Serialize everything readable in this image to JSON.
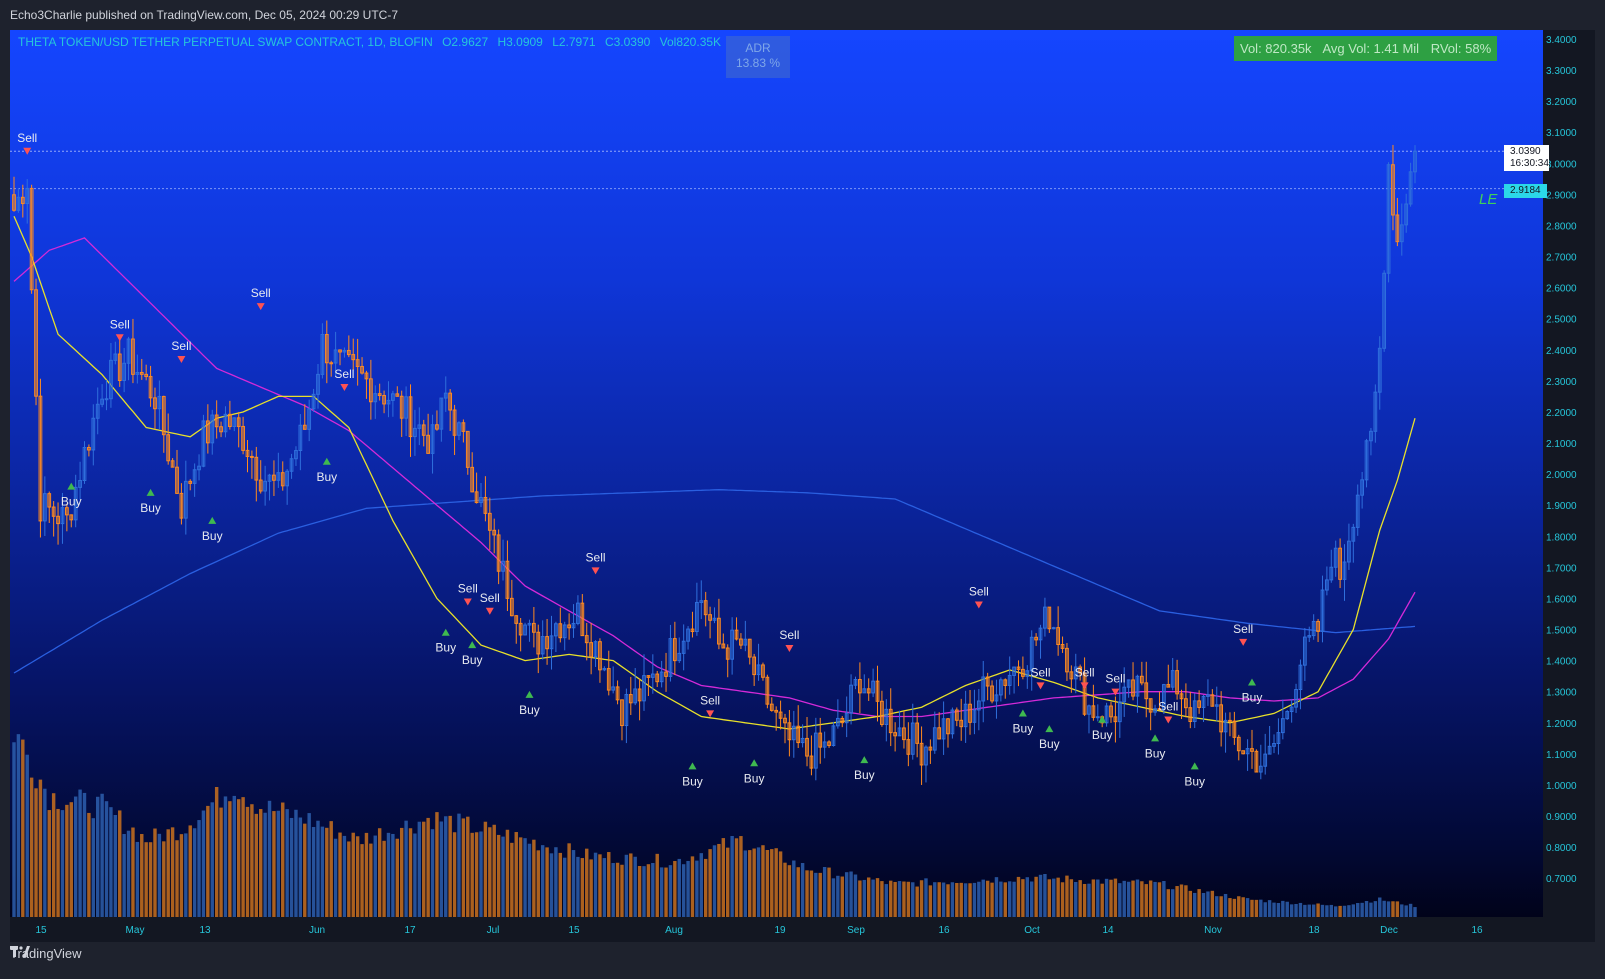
{
  "header": {
    "published_text": "Echo3Charlie published on TradingView.com, Dec 05, 2024 00:29 UTC-7"
  },
  "legend": {
    "symbol": "THETA TOKEN/USD TETHER PERPETUAL SWAP CONTRACT, 1D, BLOFIN",
    "open": "O2.9627",
    "high": "H3.0909",
    "low": "L2.7971",
    "close": "C3.0390",
    "volume": "Vol820.35K"
  },
  "adr": {
    "label": "ADR",
    "value": "13.83 %"
  },
  "volume_box": {
    "vol": "Vol: 820.35k",
    "avg": "Avg Vol: 1.41 Mil",
    "rvol": "RVol: 58%"
  },
  "le_label": "LE",
  "price_labels": {
    "last": "3.0390",
    "countdown": "16:30:34",
    "line2": "2.9184"
  },
  "footer": {
    "brand": "TradingView"
  },
  "colors": {
    "up": "#2f6fdc",
    "down": "#ff8a1f",
    "ma_fast": "#e8e02a",
    "ma_mid": "#d42ad8",
    "ma_slow": "#2a5fe0",
    "buy": "#3fb950",
    "sell": "#ff5252"
  },
  "chart_data": {
    "type": "candlestick",
    "y_axis": {
      "ticks": [
        "3.4000",
        "3.3000",
        "3.2000",
        "3.1000",
        "3.0000",
        "2.9000",
        "2.8000",
        "2.7000",
        "2.6000",
        "2.5000",
        "2.4000",
        "2.3000",
        "2.2000",
        "2.1000",
        "2.0000",
        "1.9000",
        "1.8000",
        "1.7000",
        "1.6000",
        "1.5000",
        "1.4000",
        "1.3000",
        "1.2000",
        "1.1000",
        "1.0000",
        "0.9000",
        "0.8000",
        "0.7000"
      ],
      "range": [
        0.67,
        3.42
      ]
    },
    "x_axis": {
      "ticks": [
        "15",
        "May",
        "13",
        "Jun",
        "17",
        "Jul",
        "15",
        "Aug",
        "19",
        "Sep",
        "16",
        "Oct",
        "14",
        "Nov",
        "18",
        "Dec",
        "16"
      ]
    },
    "close_path": [
      [
        0,
        2.85
      ],
      [
        3,
        2.95
      ],
      [
        6,
        1.9
      ],
      [
        12,
        1.85
      ],
      [
        20,
        2.28
      ],
      [
        26,
        2.38
      ],
      [
        32,
        2.25
      ],
      [
        38,
        1.9
      ],
      [
        43,
        2.12
      ],
      [
        48,
        2.18
      ],
      [
        52,
        2.12
      ],
      [
        56,
        2.0
      ],
      [
        60,
        1.95
      ],
      [
        66,
        2.15
      ],
      [
        70,
        2.42
      ],
      [
        74,
        2.35
      ],
      [
        80,
        2.3
      ],
      [
        85,
        2.25
      ],
      [
        90,
        2.18
      ],
      [
        95,
        2.1
      ],
      [
        98,
        2.25
      ],
      [
        103,
        2.05
      ],
      [
        108,
        1.8
      ],
      [
        113,
        1.6
      ],
      [
        118,
        1.45
      ],
      [
        123,
        1.52
      ],
      [
        128,
        1.55
      ],
      [
        133,
        1.42
      ],
      [
        138,
        1.25
      ],
      [
        143,
        1.3
      ],
      [
        148,
        1.4
      ],
      [
        152,
        1.5
      ],
      [
        156,
        1.6
      ],
      [
        160,
        1.45
      ],
      [
        165,
        1.45
      ],
      [
        170,
        1.3
      ],
      [
        175,
        1.15
      ],
      [
        180,
        1.1
      ],
      [
        184,
        1.12
      ],
      [
        188,
        1.2
      ],
      [
        192,
        1.35
      ],
      [
        196,
        1.25
      ],
      [
        201,
        1.18
      ],
      [
        206,
        1.12
      ],
      [
        210,
        1.18
      ],
      [
        215,
        1.2
      ],
      [
        220,
        1.3
      ],
      [
        225,
        1.35
      ],
      [
        230,
        1.42
      ],
      [
        235,
        1.55
      ],
      [
        239,
        1.42
      ],
      [
        244,
        1.25
      ],
      [
        249,
        1.22
      ],
      [
        254,
        1.3
      ],
      [
        259,
        1.28
      ],
      [
        264,
        1.32
      ],
      [
        268,
        1.22
      ],
      [
        272,
        1.28
      ],
      [
        276,
        1.15
      ],
      [
        281,
        1.1
      ],
      [
        284,
        1.06
      ],
      [
        288,
        1.2
      ],
      [
        292,
        1.4
      ],
      [
        296,
        1.5
      ],
      [
        299,
        1.75
      ],
      [
        301,
        1.68
      ],
      [
        305,
        1.95
      ],
      [
        308,
        2.1
      ],
      [
        310,
        2.4
      ],
      [
        312,
        3.0
      ],
      [
        314,
        2.75
      ],
      [
        316,
        2.9
      ],
      [
        318,
        3.04
      ]
    ],
    "volume_profile": [
      [
        0,
        0.85
      ],
      [
        8,
        0.55
      ],
      [
        20,
        0.5
      ],
      [
        30,
        0.35
      ],
      [
        38,
        0.4
      ],
      [
        50,
        0.6
      ],
      [
        56,
        0.5
      ],
      [
        66,
        0.45
      ],
      [
        78,
        0.35
      ],
      [
        95,
        0.45
      ],
      [
        110,
        0.38
      ],
      [
        130,
        0.28
      ],
      [
        150,
        0.25
      ],
      [
        165,
        0.35
      ],
      [
        180,
        0.22
      ],
      [
        200,
        0.15
      ],
      [
        230,
        0.18
      ],
      [
        260,
        0.15
      ],
      [
        280,
        0.08
      ],
      [
        300,
        0.05
      ],
      [
        310,
        0.08
      ],
      [
        318,
        0.05
      ]
    ],
    "ma_fast": [
      [
        0,
        2.83
      ],
      [
        4,
        2.7
      ],
      [
        10,
        2.45
      ],
      [
        20,
        2.32
      ],
      [
        30,
        2.15
      ],
      [
        40,
        2.12
      ],
      [
        46,
        2.18
      ],
      [
        52,
        2.2
      ],
      [
        60,
        2.25
      ],
      [
        68,
        2.25
      ],
      [
        76,
        2.15
      ],
      [
        86,
        1.85
      ],
      [
        96,
        1.6
      ],
      [
        106,
        1.45
      ],
      [
        116,
        1.4
      ],
      [
        126,
        1.42
      ],
      [
        136,
        1.4
      ],
      [
        146,
        1.3
      ],
      [
        156,
        1.22
      ],
      [
        166,
        1.2
      ],
      [
        176,
        1.18
      ],
      [
        186,
        1.2
      ],
      [
        196,
        1.22
      ],
      [
        206,
        1.25
      ],
      [
        216,
        1.32
      ],
      [
        226,
        1.37
      ],
      [
        236,
        1.33
      ],
      [
        246,
        1.28
      ],
      [
        256,
        1.25
      ],
      [
        266,
        1.22
      ],
      [
        276,
        1.2
      ],
      [
        286,
        1.23
      ],
      [
        296,
        1.3
      ],
      [
        304,
        1.5
      ],
      [
        310,
        1.82
      ],
      [
        314,
        1.98
      ],
      [
        318,
        2.18
      ]
    ],
    "ma_mid": [
      [
        0,
        2.62
      ],
      [
        8,
        2.72
      ],
      [
        16,
        2.76
      ],
      [
        26,
        2.62
      ],
      [
        36,
        2.48
      ],
      [
        46,
        2.34
      ],
      [
        56,
        2.28
      ],
      [
        66,
        2.22
      ],
      [
        76,
        2.14
      ],
      [
        86,
        2.02
      ],
      [
        96,
        1.9
      ],
      [
        106,
        1.78
      ],
      [
        116,
        1.64
      ],
      [
        126,
        1.56
      ],
      [
        136,
        1.48
      ],
      [
        146,
        1.38
      ],
      [
        156,
        1.32
      ],
      [
        166,
        1.3
      ],
      [
        176,
        1.28
      ],
      [
        186,
        1.24
      ],
      [
        196,
        1.22
      ],
      [
        206,
        1.22
      ],
      [
        216,
        1.24
      ],
      [
        226,
        1.26
      ],
      [
        236,
        1.28
      ],
      [
        246,
        1.29
      ],
      [
        256,
        1.3
      ],
      [
        266,
        1.3
      ],
      [
        276,
        1.28
      ],
      [
        286,
        1.27
      ],
      [
        296,
        1.28
      ],
      [
        304,
        1.34
      ],
      [
        312,
        1.47
      ],
      [
        318,
        1.62
      ]
    ],
    "ma_slow": [
      [
        0,
        1.36
      ],
      [
        20,
        1.53
      ],
      [
        40,
        1.68
      ],
      [
        60,
        1.81
      ],
      [
        80,
        1.89
      ],
      [
        100,
        1.91
      ],
      [
        120,
        1.93
      ],
      [
        140,
        1.94
      ],
      [
        160,
        1.95
      ],
      [
        180,
        1.94
      ],
      [
        200,
        1.92
      ],
      [
        220,
        1.8
      ],
      [
        240,
        1.68
      ],
      [
        260,
        1.56
      ],
      [
        280,
        1.52
      ],
      [
        300,
        1.49
      ],
      [
        318,
        1.51
      ]
    ],
    "signals": [
      {
        "type": "Sell",
        "i": 3,
        "price": 3.05
      },
      {
        "type": "Buy",
        "i": 13,
        "price": 1.95
      },
      {
        "type": "Sell",
        "i": 24,
        "price": 2.45
      },
      {
        "type": "Buy",
        "i": 31,
        "price": 1.93
      },
      {
        "type": "Sell",
        "i": 38,
        "price": 2.38
      },
      {
        "type": "Buy",
        "i": 45,
        "price": 1.84
      },
      {
        "type": "Sell",
        "i": 56,
        "price": 2.55
      },
      {
        "type": "Sell",
        "i": 75,
        "price": 2.29
      },
      {
        "type": "Buy",
        "i": 71,
        "price": 2.03
      },
      {
        "type": "Buy",
        "i": 98,
        "price": 1.48
      },
      {
        "type": "Sell",
        "i": 103,
        "price": 1.6
      },
      {
        "type": "Buy",
        "i": 104,
        "price": 1.44
      },
      {
        "type": "Sell",
        "i": 108,
        "price": 1.57
      },
      {
        "type": "Buy",
        "i": 117,
        "price": 1.28
      },
      {
        "type": "Sell",
        "i": 132,
        "price": 1.7
      },
      {
        "type": "Buy",
        "i": 154,
        "price": 1.05
      },
      {
        "type": "Sell",
        "i": 158,
        "price": 1.24
      },
      {
        "type": "Buy",
        "i": 168,
        "price": 1.06
      },
      {
        "type": "Sell",
        "i": 176,
        "price": 1.45
      },
      {
        "type": "Buy",
        "i": 193,
        "price": 1.07
      },
      {
        "type": "Sell",
        "i": 219,
        "price": 1.59
      },
      {
        "type": "Buy",
        "i": 229,
        "price": 1.22
      },
      {
        "type": "Sell",
        "i": 233,
        "price": 1.33
      },
      {
        "type": "Buy",
        "i": 235,
        "price": 1.17
      },
      {
        "type": "Sell",
        "i": 243,
        "price": 1.33
      },
      {
        "type": "Buy",
        "i": 247,
        "price": 1.2
      },
      {
        "type": "Sell",
        "i": 250,
        "price": 1.31
      },
      {
        "type": "Buy",
        "i": 259,
        "price": 1.14
      },
      {
        "type": "Sell",
        "i": 262,
        "price": 1.22
      },
      {
        "type": "Buy",
        "i": 268,
        "price": 1.05
      },
      {
        "type": "Sell",
        "i": 279,
        "price": 1.47
      },
      {
        "type": "Buy",
        "i": 281,
        "price": 1.32
      }
    ]
  }
}
